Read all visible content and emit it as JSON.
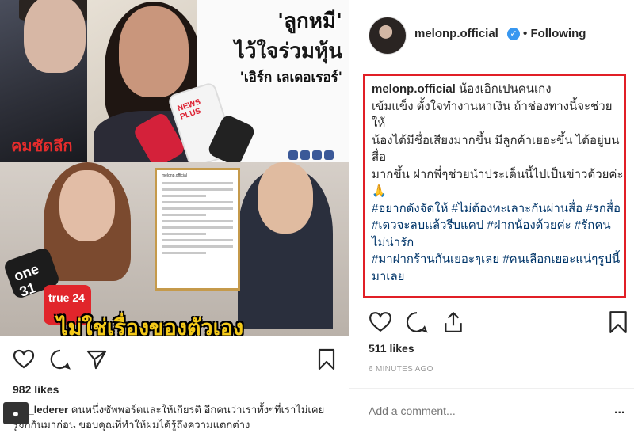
{
  "left_post": {
    "image": {
      "headline_1": "'ลูกหมี'",
      "headline_2": "ไว้ใจร่วมหุ้น",
      "headline_3": "'เอิร์ก เลเดอเรอร์'",
      "mic_label": "NEWS PLUS",
      "logo_text": "คมชัดลึก",
      "mic_d_label": "one 31",
      "mic_e_label": "true 24",
      "banner": "ไม่ใช่เรื่องของตัวเอง",
      "screenshot_head": "melonp.official"
    },
    "actions": {
      "like_icon": "heart-icon",
      "comment_icon": "comment-bubble-icon",
      "share_icon": "paper-plane-icon",
      "save_icon": "bookmark-icon"
    },
    "likes": "982 likes",
    "caption": {
      "username": "erk_lederer",
      "text": "คนหนึ่งซัพพอร์ตและให้เกียรติ อีกคนว่าเราทั้งๆที่เราไม่เคยรู้จักกันมาก่อน ขอบคุณที่ทำให้ผมได้รู้ถึงความแตกต่าง"
    }
  },
  "right_post": {
    "header": {
      "username": "melonp.official",
      "verified_icon": "verified-badge-icon",
      "separator": "•",
      "follow_status": "Following"
    },
    "comment": {
      "username": "melonp.official",
      "lines": [
        "น้องเอิกเปนคนเก่ง",
        "เข้มแข็ง ตั้งใจทำงานหาเงิน ถ้าช่องทางนี้จะช่วยให้",
        "น้องได้มีชื่อเสียงมากขึ้น มีลูกค้าเยอะขึ้น ได้อยู่บนสื่อ",
        "มากขึ้น ฝากพี่ๆช่วยนำประเด็นนี้ไปเป็นข่าวด้วยค่ะ 🙏"
      ],
      "hashtags": [
        "#อยากดังจัดให้ #ไม่ต้องทะเลาะกันผ่านสื่อ #รกสื่อ",
        "#เดวจะลบแล้วรีบแคป #ฝากน้องด้วยค่ะ #รักคนไม่น่ารัก",
        "#มาฝากร้านกันเยอะๆเลย #คนเลือกเยอะแน่ๆรูปนี้มาเลย"
      ]
    },
    "actions": {
      "like_icon": "heart-icon",
      "comment_icon": "comment-bubble-icon",
      "share_icon": "share-upload-icon",
      "save_icon": "bookmark-icon"
    },
    "likes": "511 likes",
    "time": "6 MINUTES AGO",
    "comment_input": {
      "placeholder": "Add a comment..."
    },
    "more_label": "..."
  }
}
